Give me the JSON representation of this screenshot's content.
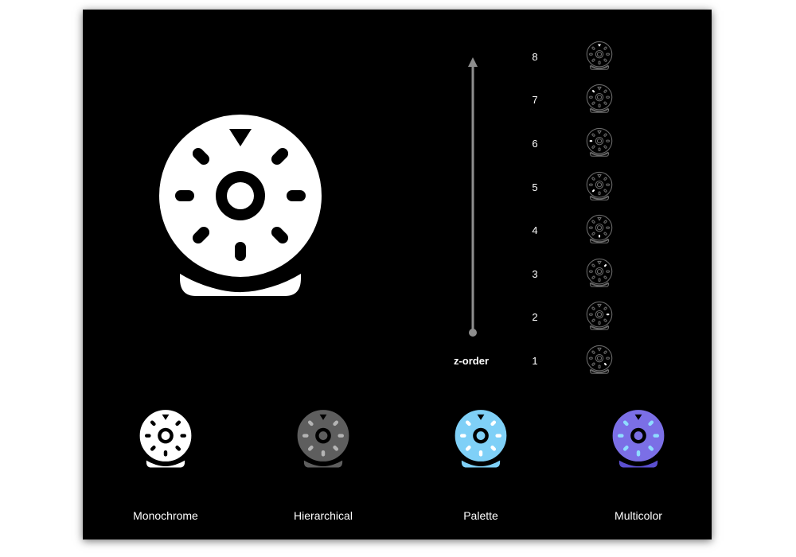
{
  "axis_label": "z-order",
  "layers": [
    "1",
    "2",
    "3",
    "4",
    "5",
    "6",
    "7",
    "8"
  ],
  "styles": [
    {
      "label": "Monochrome",
      "face": "#ffffff",
      "base": "#ffffff",
      "ring": "#000000",
      "marks": "#000000",
      "marks_alt": "#000000"
    },
    {
      "label": "Hierarchical",
      "face": "#5e5e5e",
      "base": "#5e5e5e",
      "ring": "#000000",
      "marks": "#000000",
      "marks_alt": "#b4b4b4"
    },
    {
      "label": "Palette",
      "face": "#7fd0f7",
      "base": "#7fd0f7",
      "ring": "#000000",
      "marks": "#000000",
      "marks_alt": "#ffffff"
    },
    {
      "label": "Multicolor",
      "face": "#7b6fe6",
      "base": "#5b4fcf",
      "ring": "#000000",
      "marks": "#000000",
      "marks_alt": "#8fdcff"
    }
  ],
  "colors": {
    "background": "#000000",
    "icon_fill": "#ffffff",
    "axis": "#8e8e8e",
    "layer_outline": "#6a6a6a",
    "layer_highlight": "#ffffff"
  },
  "icon_name": "speaker-ring-icon"
}
